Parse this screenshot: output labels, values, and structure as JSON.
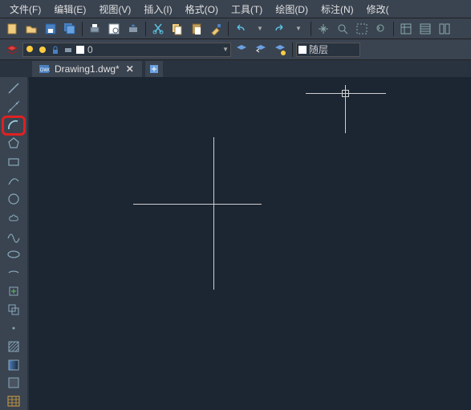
{
  "menubar": {
    "items": [
      "文件(F)",
      "编辑(E)",
      "视图(V)",
      "插入(I)",
      "格式(O)",
      "工具(T)",
      "绘图(D)",
      "标注(N)",
      "修改("
    ]
  },
  "layer": {
    "current": "0",
    "bylayer": "随层"
  },
  "tab": {
    "title": "Drawing1.dwg*"
  },
  "palette": [
    {
      "name": "line-tool",
      "svg": "line",
      "hl": false
    },
    {
      "name": "construction-line-tool",
      "svg": "xline",
      "hl": false
    },
    {
      "name": "arc-tool",
      "svg": "arc",
      "hl": true
    },
    {
      "name": "polygon-tool",
      "svg": "polygon",
      "hl": false
    },
    {
      "name": "rectangle-tool",
      "svg": "rect",
      "hl": false
    },
    {
      "name": "arc2-tool",
      "svg": "arc2",
      "hl": false
    },
    {
      "name": "circle-tool",
      "svg": "circle",
      "hl": false
    },
    {
      "name": "revision-cloud-tool",
      "svg": "cloud",
      "hl": false
    },
    {
      "name": "spline-tool",
      "svg": "spline",
      "hl": false
    },
    {
      "name": "ellipse-tool",
      "svg": "ellipse",
      "hl": false
    },
    {
      "name": "ellipse-arc-tool",
      "svg": "earc",
      "hl": false
    },
    {
      "name": "block-tool",
      "svg": "block",
      "hl": false
    },
    {
      "name": "insert-block-tool",
      "svg": "iblock",
      "hl": false
    },
    {
      "name": "point-tool",
      "svg": "point",
      "hl": false
    },
    {
      "name": "hatch-tool",
      "svg": "hatch",
      "hl": false
    },
    {
      "name": "gradient-tool",
      "svg": "grad",
      "hl": false
    },
    {
      "name": "region-tool",
      "svg": "region",
      "hl": false
    },
    {
      "name": "table-tool",
      "svg": "table",
      "hl": false
    }
  ]
}
